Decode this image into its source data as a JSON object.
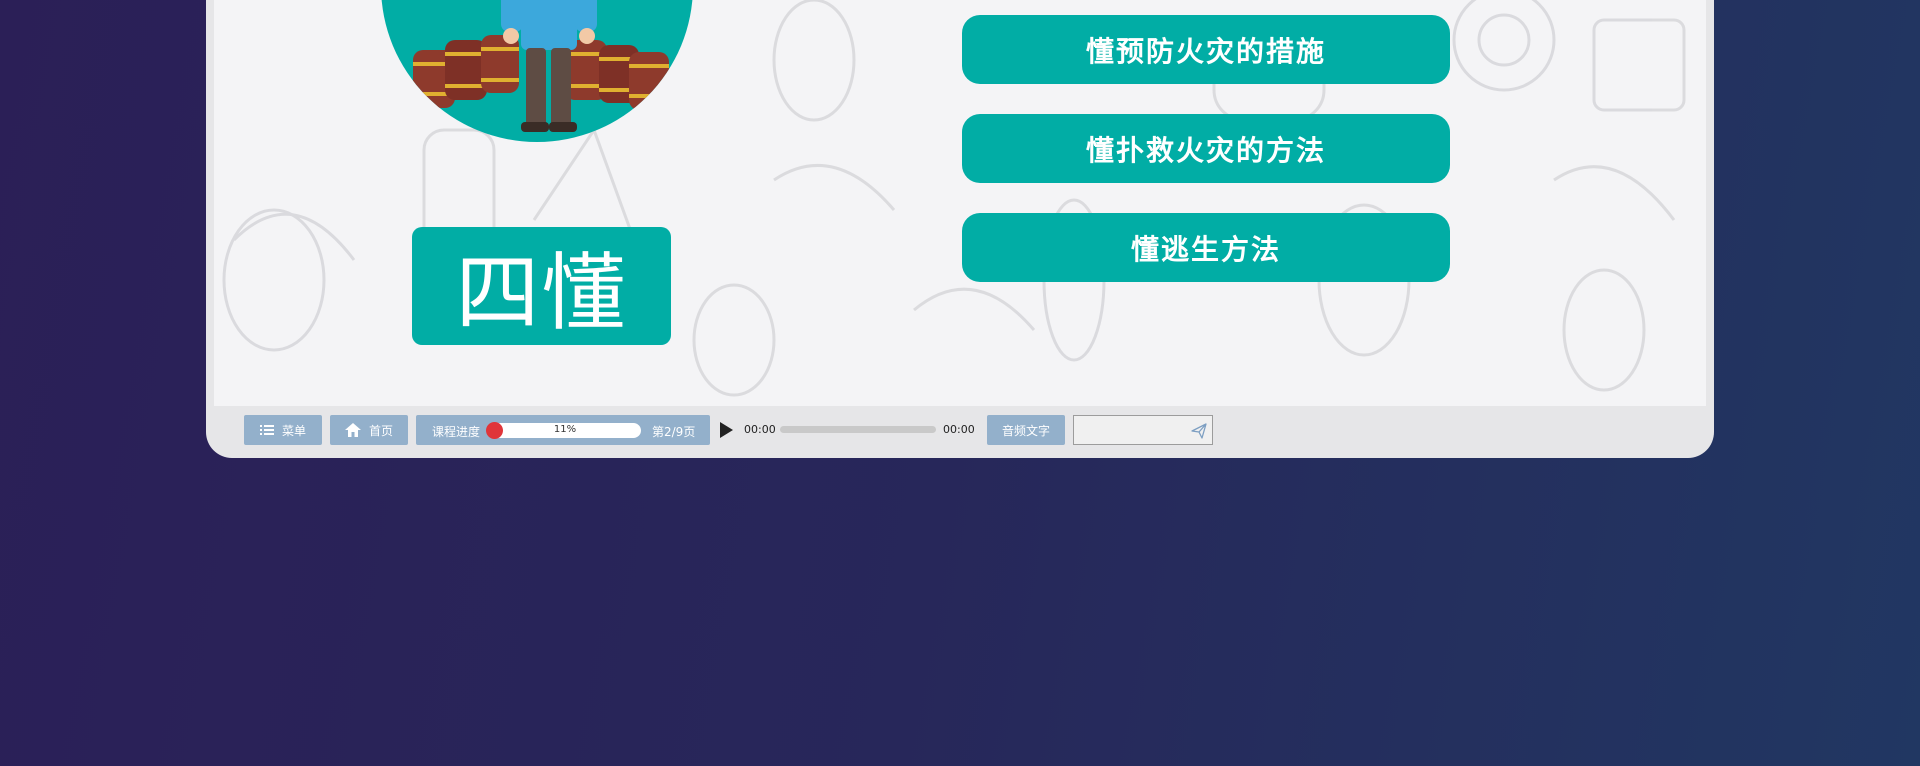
{
  "slide": {
    "title": "四懂",
    "items": [
      {
        "label": "懂预防火灾的措施"
      },
      {
        "label": "懂扑救火灾的方法"
      },
      {
        "label": "懂逃生方法"
      }
    ]
  },
  "toolbar": {
    "menu_label": "菜单",
    "home_label": "首页",
    "progress_label": "课程进度",
    "progress_percent": "11%",
    "progress_value": 0.11,
    "page_label": "第2/9页",
    "time_current": "00:00",
    "time_total": "00:00",
    "audio_text_label": "音频文字",
    "input_value": ""
  },
  "colors": {
    "accent": "#01ada5",
    "toolbar_button": "#93b0cb",
    "progress_dot": "#e0353a"
  },
  "icons": [
    "list-icon",
    "home-icon",
    "play-icon",
    "send-icon"
  ]
}
